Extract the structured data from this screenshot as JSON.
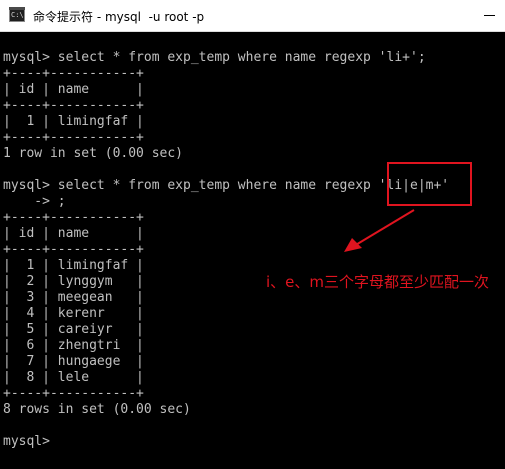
{
  "window": {
    "icon_text": "C:\\",
    "title": "命令提示符 - mysql  -u root -p"
  },
  "console": {
    "lines": [
      "mysql> select * from exp_temp where name regexp 'li+';",
      "+----+-----------+",
      "| id | name      |",
      "+----+-----------+",
      "|  1 | limingfaf |",
      "+----+-----------+",
      "1 row in set (0.00 sec)",
      "",
      "mysql> select * from exp_temp where name regexp 'li|e|m+'",
      "    -> ;",
      "+----+-----------+",
      "| id | name      |",
      "+----+-----------+",
      "|  1 | limingfaf |",
      "|  2 | lynggym   |",
      "|  3 | meegean   |",
      "|  4 | kerenr    |",
      "|  5 | careiyr   |",
      "|  6 | zhengtri  |",
      "|  7 | hungaege  |",
      "|  8 | lele      |",
      "+----+-----------+",
      "8 rows in set (0.00 sec)",
      "",
      "mysql>"
    ]
  },
  "annotation": {
    "text": "i、e、m三个字母都至少匹配一次",
    "color": "#e0141f"
  }
}
